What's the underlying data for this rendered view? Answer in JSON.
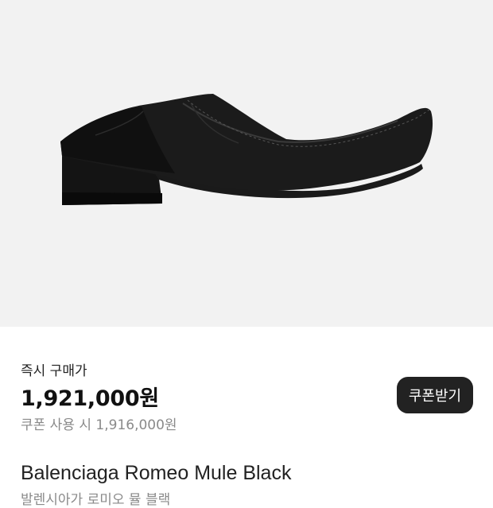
{
  "product": {
    "image_alt_icon": "shoe-image",
    "name": "Balenciaga Romeo Mule Black",
    "subtitle": "발렌시아가 로미오 뮬 블랙"
  },
  "pricing": {
    "instant_buy_label": "즉시 구매가",
    "price": "1,921,000원",
    "coupon_price_text": "쿠폰 사용 시 1,916,000원",
    "coupon_button_label": "쿠폰받기"
  },
  "colors": {
    "hero_bg": "#f2f2f2",
    "button_bg": "#222222",
    "muted_text": "#8a8a8a"
  }
}
